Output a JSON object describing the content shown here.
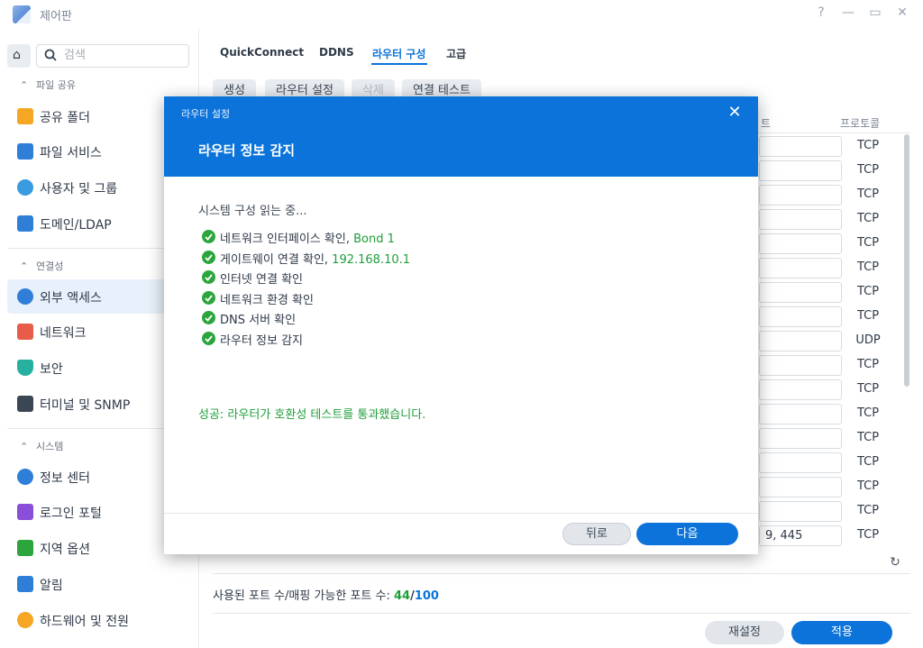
{
  "window": {
    "title": "제어판",
    "controls": [
      "?",
      "—",
      "▭",
      "✕"
    ]
  },
  "sidebar": {
    "search_placeholder": "검색",
    "sections": [
      {
        "header": "파일 공유",
        "items": [
          {
            "label": "공유 폴더",
            "icon": "folder-icon",
            "color": "#f5a623"
          },
          {
            "label": "파일 서비스",
            "icon": "file-services-icon",
            "color": "#2f7fd8"
          },
          {
            "label": "사용자 및 그룹",
            "icon": "users-icon",
            "color": "#3a9be0"
          },
          {
            "label": "도메인/LDAP",
            "icon": "domain-icon",
            "color": "#2f7fd8"
          }
        ]
      },
      {
        "header": "연결성",
        "items": [
          {
            "label": "외부 액세스",
            "icon": "external-access-icon",
            "color": "#2f7fd8",
            "active": true
          },
          {
            "label": "네트워크",
            "icon": "house-icon",
            "color": "#e85d4a"
          },
          {
            "label": "보안",
            "icon": "shield-icon",
            "color": "#27b0a0"
          },
          {
            "label": "터미널 및 SNMP",
            "icon": "terminal-icon",
            "color": "#3b4654"
          }
        ]
      },
      {
        "header": "시스템",
        "items": [
          {
            "label": "정보 센터",
            "icon": "info-icon",
            "color": "#2f7fd8"
          },
          {
            "label": "로그인 포털",
            "icon": "login-portal-icon",
            "color": "#8a4fd8"
          },
          {
            "label": "지역 옵션",
            "icon": "regional-icon",
            "color": "#2ca53c"
          },
          {
            "label": "알림",
            "icon": "notification-icon",
            "color": "#2f7fd8"
          },
          {
            "label": "하드웨어 및 전원",
            "icon": "bulb-icon",
            "color": "#f5a623"
          }
        ]
      }
    ]
  },
  "main": {
    "tabs": [
      {
        "label": "QuickConnect"
      },
      {
        "label": "DDNS"
      },
      {
        "label": "라우터 구성",
        "active": true
      },
      {
        "label": "고급"
      }
    ],
    "toolbar": {
      "create": "생성",
      "router_settings": "라우터 설정",
      "delete": "삭제",
      "connection_test": "연결 테스트"
    },
    "table": {
      "header_fragment": "트",
      "protocol_header": "프로토콜",
      "rows": [
        {
          "port": "",
          "protocol": "TCP"
        },
        {
          "port": "",
          "protocol": "TCP"
        },
        {
          "port": "",
          "protocol": "TCP"
        },
        {
          "port": "",
          "protocol": "TCP"
        },
        {
          "port": "",
          "protocol": "TCP"
        },
        {
          "port": "",
          "protocol": "TCP"
        },
        {
          "port": "",
          "protocol": "TCP"
        },
        {
          "port": "",
          "protocol": "TCP"
        },
        {
          "port": "",
          "protocol": "UDP"
        },
        {
          "port": "",
          "protocol": "TCP"
        },
        {
          "port": "",
          "protocol": "TCP"
        },
        {
          "port": "",
          "protocol": "TCP"
        },
        {
          "port": "",
          "protocol": "TCP"
        },
        {
          "port": "",
          "protocol": "TCP"
        },
        {
          "port": "",
          "protocol": "TCP"
        },
        {
          "port": "",
          "protocol": "TCP"
        },
        {
          "port": "9, 445",
          "protocol": "TCP"
        }
      ]
    },
    "port_count": {
      "label": "사용된 포트 수/매핑 가능한 포트 수: ",
      "used": "44",
      "separator": "/",
      "total": "100"
    },
    "buttons": {
      "reset": "재설정",
      "apply": "적용"
    }
  },
  "dialog": {
    "small_title": "라우터 설정",
    "close": "✕",
    "title": "라우터 정보 감지",
    "reading": "시스템 구성 읽는 중...",
    "checks": [
      {
        "label": "네트워크 인터페이스 확인, ",
        "value": "Bond 1"
      },
      {
        "label": "게이트웨이 연결 확인, ",
        "value": "192.168.10.1"
      },
      {
        "label": "인터넷 연결 확인",
        "value": ""
      },
      {
        "label": "네트워크 환경 확인",
        "value": ""
      },
      {
        "label": "DNS 서버 확인",
        "value": ""
      },
      {
        "label": "라우터 정보 감지",
        "value": ""
      }
    ],
    "success": "성공: 라우터가 호환성 테스트를 통과했습니다.",
    "back": "뒤로",
    "next": "다음"
  }
}
